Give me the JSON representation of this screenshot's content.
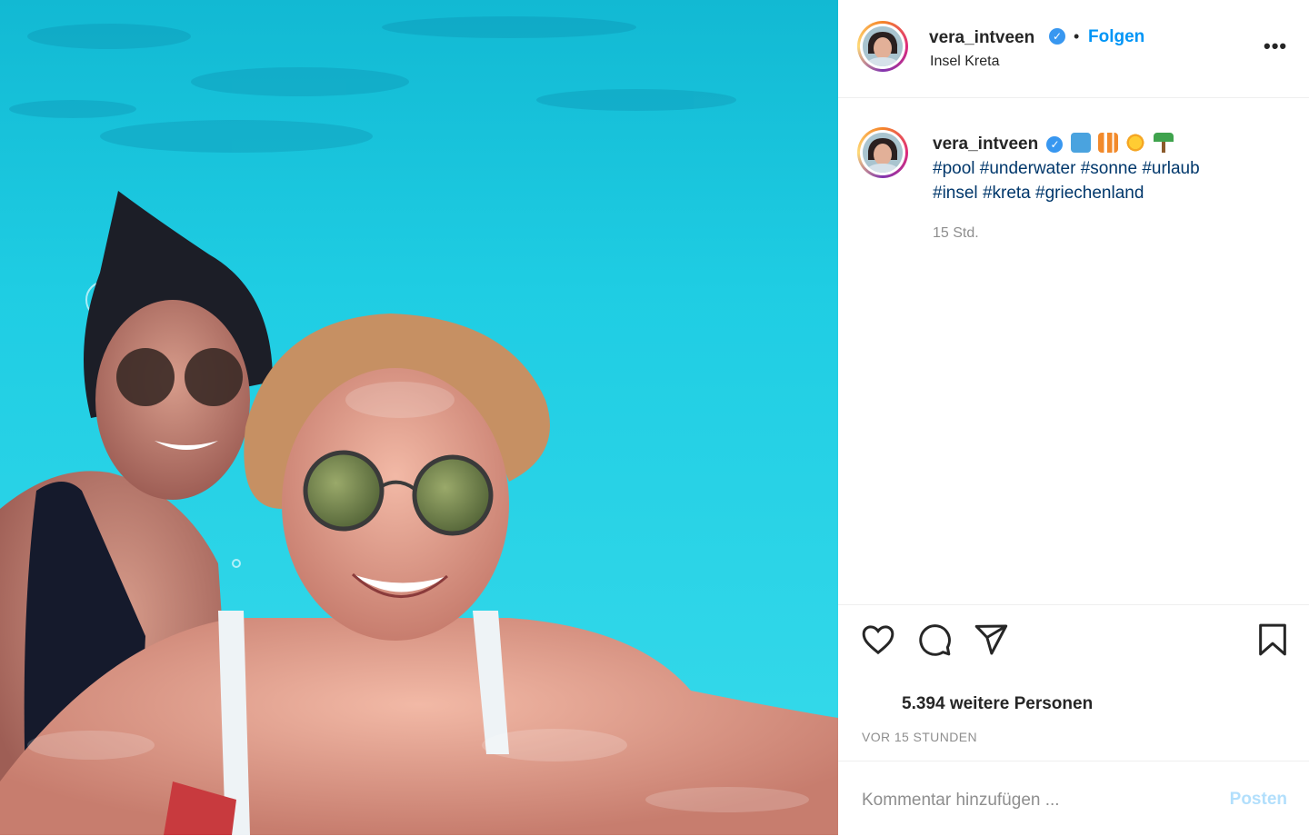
{
  "header": {
    "username": "vera_intveen",
    "separator": "•",
    "follow_label": "Folgen",
    "location": "Insel Kreta",
    "more_icon": "more-horizontal-icon"
  },
  "caption": {
    "username": "vera_intveen",
    "emoji": [
      "fish-emoji",
      "tropical-fish-emoji",
      "sun-emoji",
      "palm-tree-emoji"
    ],
    "hashtags_line1": [
      "#pool",
      "#underwater",
      "#sonne",
      "#urlaub"
    ],
    "hashtags_line2": [
      "#insel",
      "#kreta",
      "#griechenland"
    ],
    "time": "15 Std."
  },
  "actions": {
    "icons": [
      "heart-icon",
      "comment-icon",
      "share-icon",
      "bookmark-icon"
    ],
    "likes_text": "5.394 weitere Personen",
    "post_time": "VOR 15 STUNDEN"
  },
  "comment": {
    "placeholder": "Kommentar hinzufügen ...",
    "post_label": "Posten"
  },
  "colors": {
    "accent": "#0095f6",
    "verified": "#3897f0",
    "hashtag": "#00376b",
    "water": "#25d3e6"
  }
}
